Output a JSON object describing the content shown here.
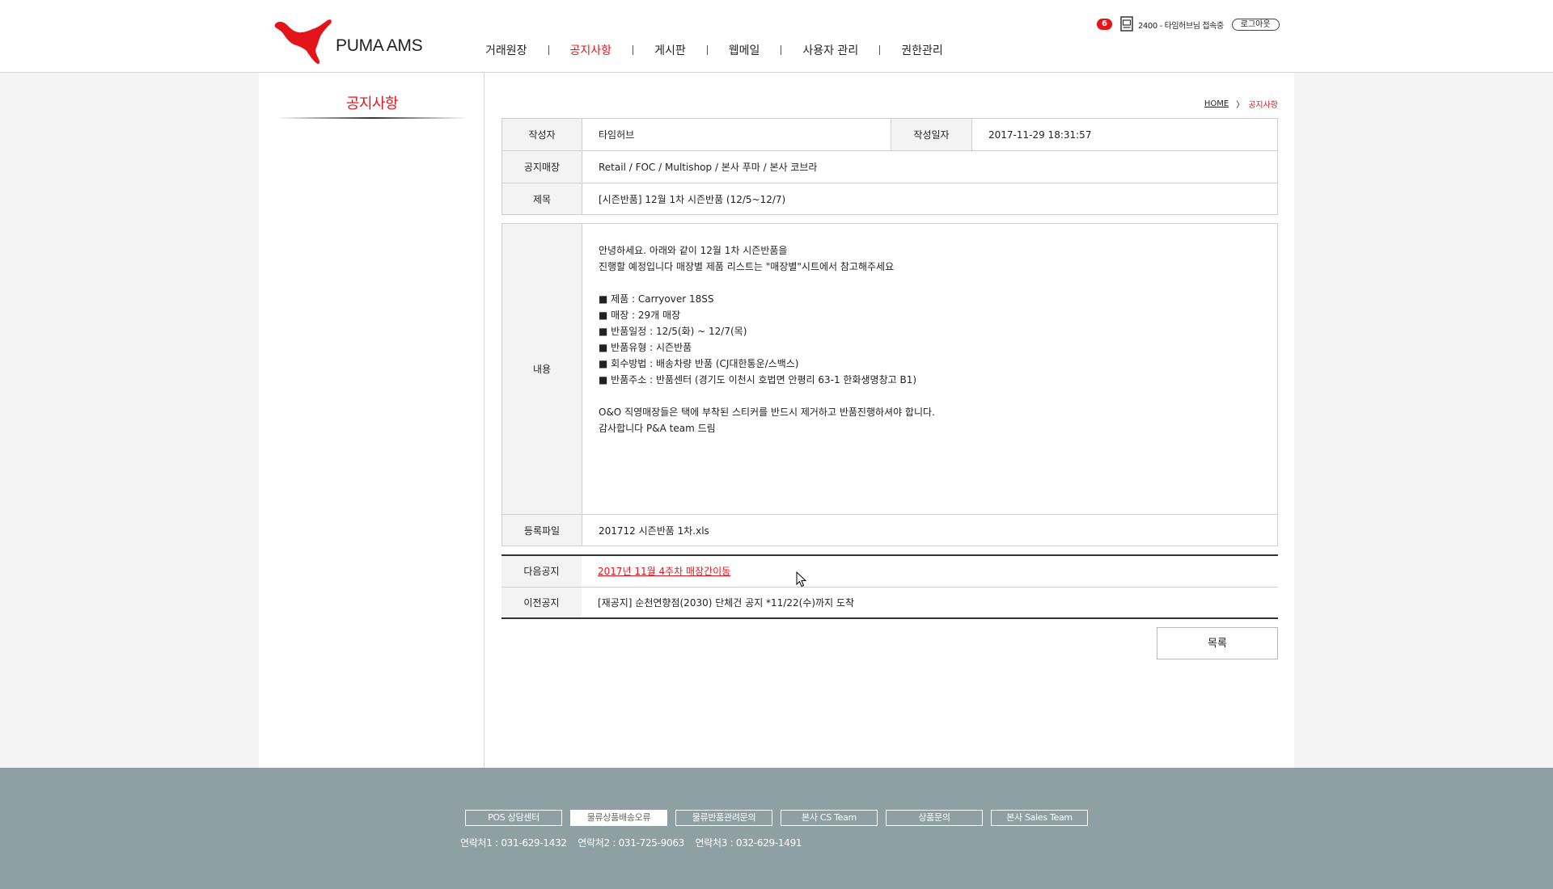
{
  "header": {
    "logo_text": "PUMA AMS",
    "nav": [
      "거래원장",
      "공지사항",
      "게시판",
      "웹메일",
      "사용자 관리",
      "권한관리"
    ],
    "active_nav": "공지사항",
    "badge_count": "6",
    "user_text": "2400 - 타임허브님 접속중",
    "logout_label": "로그아웃"
  },
  "sidebar": {
    "title": "공지사항"
  },
  "breadcrumb": {
    "home": "HOME",
    "current": "공지사항"
  },
  "notice": {
    "author_label": "작성자",
    "author": "타임허브",
    "date_label": "작성일자",
    "date": "2017-11-29 18:31:57",
    "store_label": "공지매장",
    "stores": "Retail / FOC / Multishop / 본사 푸마 / 본사 코브라",
    "subject_label": "제목",
    "subject": "[시즌반품] 12월 1차 시즌반품 (12/5~12/7)",
    "body_label": "내용",
    "body_lines": [
      "안녕하세요. 아래와 같이 12월 1차 시즌반품을",
      "진행할 예정입니다 매장별 제품 리스트는 \"매장별\"시트에서 참고해주세요",
      "",
      "■ 제품 : Carryover 18SS",
      "■ 매장 : 29개 매장",
      "■ 반품일정 : 12/5(화) ~ 12/7(목)",
      "■ 반품유형 : 시즌반품",
      "■ 회수방법 : 배송차량 반품 (CJ대한통운/스백스)",
      "■ 반품주소 : 반품센터 (경기도 이천시 호법면 안평리 63-1 한화생명창고 B1)",
      "",
      "O&O 직영매장들은 택에 부착된 스티커를 반드시 제거하고 반품진행하셔야 합니다.",
      "감사합니다 P&A team 드림"
    ],
    "file_label": "등록파일",
    "file_name": "201712 시즌반품 1차.xls"
  },
  "navigation": {
    "next_label": "다음공지",
    "next_title": "2017년 11월 4주차 매장간이동",
    "prev_label": "이전공지",
    "prev_title": "[재공지] 순천연향점(2030) 단체건 공지 *11/22(수)까지 도착"
  },
  "list_button": "목록",
  "footer": {
    "links": [
      "POS 상담센터",
      "물류상품배송오류",
      "물류반품관려문의",
      "본사 CS Team",
      "상품문의",
      "본사 Sales Team"
    ],
    "active_link": "물류상품배송오류",
    "contacts": [
      "연락처1 : 031-629-1432",
      "연락처2 : 031-725-9063",
      "연락처3 : 032-629-1491"
    ]
  },
  "colors": {
    "accent": "#e4141b",
    "footer_bg": "#8fa0a5",
    "header_cell_bg": "#f3f3f3"
  },
  "icons": [
    "puma-cat-logo-icon",
    "message-icon",
    "mouse-cursor-icon"
  ]
}
